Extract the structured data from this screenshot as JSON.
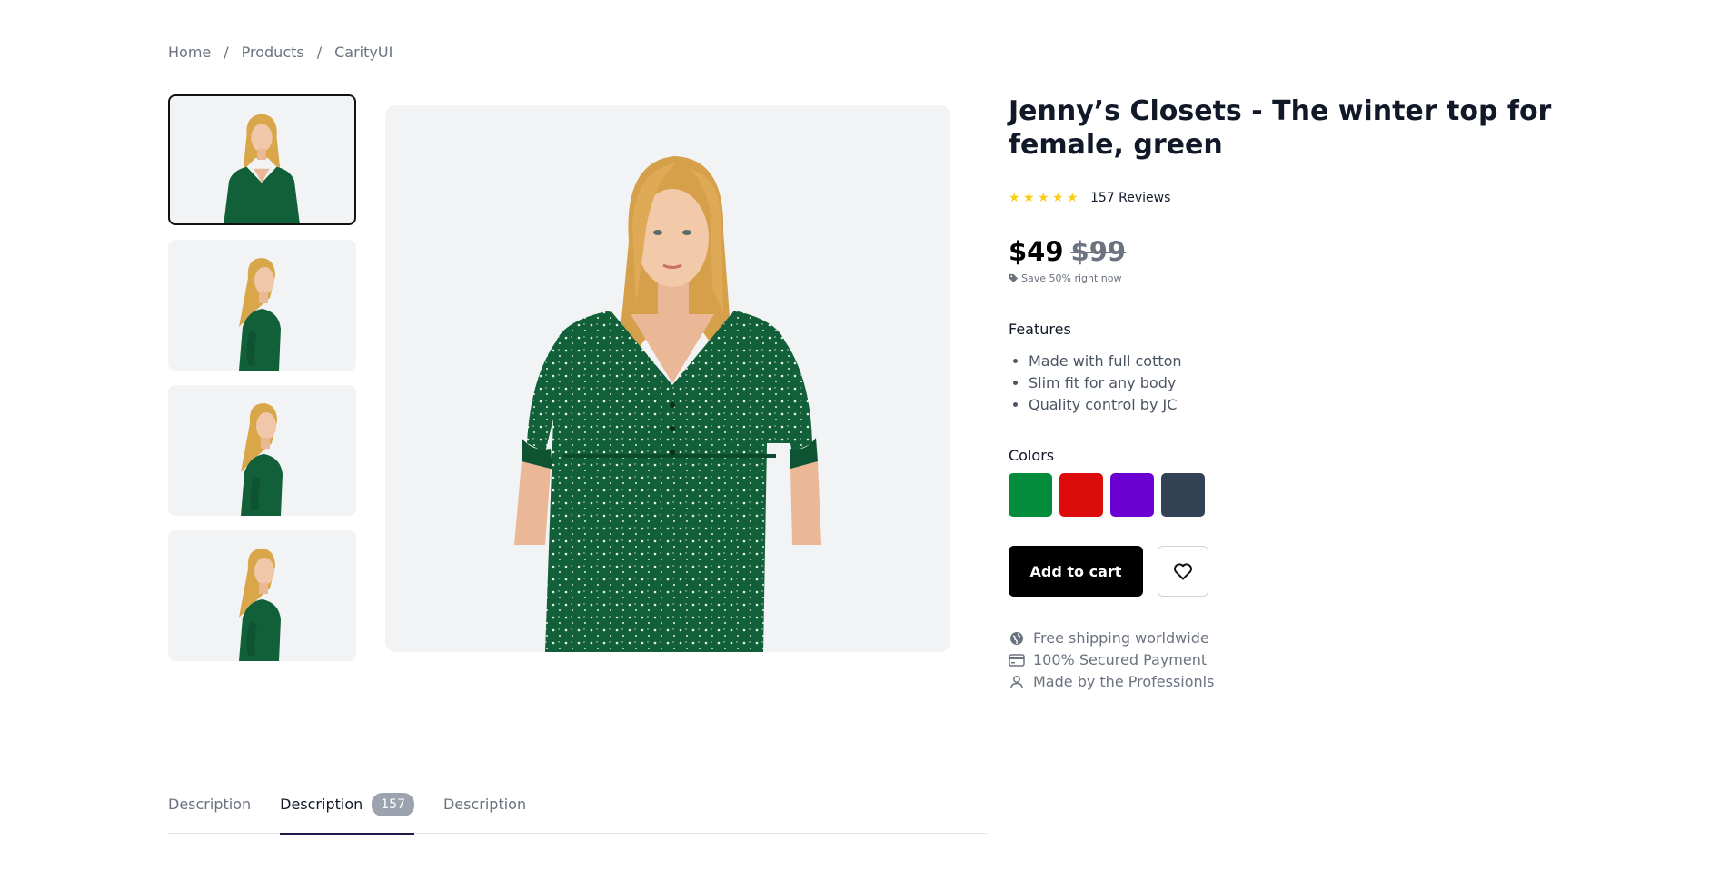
{
  "breadcrumb": {
    "items": [
      "Home",
      "Products",
      "CarityUI"
    ],
    "separator": "/"
  },
  "product": {
    "title": "Jenny’s Closets - The winter top for female, green",
    "rating_stars": 5,
    "reviews": "157 Reviews",
    "price": "$49",
    "old_price": "$99",
    "save_text": "Save 50% right now",
    "features_title": "Features",
    "features": [
      "Made with full cotton",
      "Slim fit for any body",
      "Quality control by JC"
    ],
    "colors_title": "Colors",
    "colors": [
      "#028c3b",
      "#dc0b0b",
      "#6a00d1",
      "#334155"
    ],
    "add_to_cart": "Add to cart",
    "perks": [
      {
        "icon": "globe-icon",
        "label": "Free shipping worldwide"
      },
      {
        "icon": "credit-card-icon",
        "label": "100% Secured Payment"
      },
      {
        "icon": "user-icon",
        "label": "Made by the Professionls"
      }
    ]
  },
  "gallery": {
    "thumbnail_count": 4,
    "active_thumbnail": 0,
    "dress_color": "#12603a"
  },
  "tabs": [
    {
      "label": "Description",
      "badge": null,
      "active": false
    },
    {
      "label": "Description",
      "badge": "157",
      "active": true
    },
    {
      "label": "Description",
      "badge": null,
      "active": false
    }
  ]
}
